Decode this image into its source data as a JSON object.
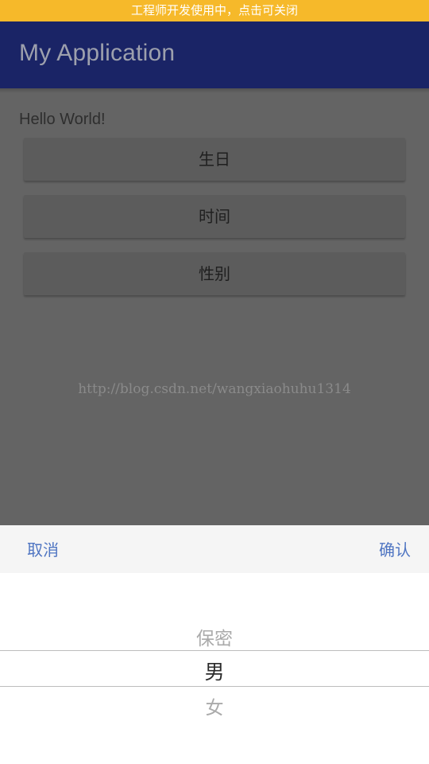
{
  "dev_banner": {
    "text": "工程师开发使用中，点击可关闭"
  },
  "app_bar": {
    "title": "My Application"
  },
  "content": {
    "hello_text": "Hello World!",
    "buttons": [
      {
        "label": "生日"
      },
      {
        "label": "时间"
      },
      {
        "label": "性别"
      }
    ],
    "watermark": "http://blog.csdn.net/wangxiaohuhu1314"
  },
  "picker": {
    "cancel_label": "取消",
    "confirm_label": "确认",
    "options": [
      {
        "label": "保密"
      },
      {
        "label": "男"
      },
      {
        "label": "女"
      }
    ],
    "selected_index": 1
  },
  "colors": {
    "banner": "#f6b92a",
    "app_bar": "#1a2466",
    "accent": "#4f75c2",
    "dim_overlay": "#646464"
  }
}
